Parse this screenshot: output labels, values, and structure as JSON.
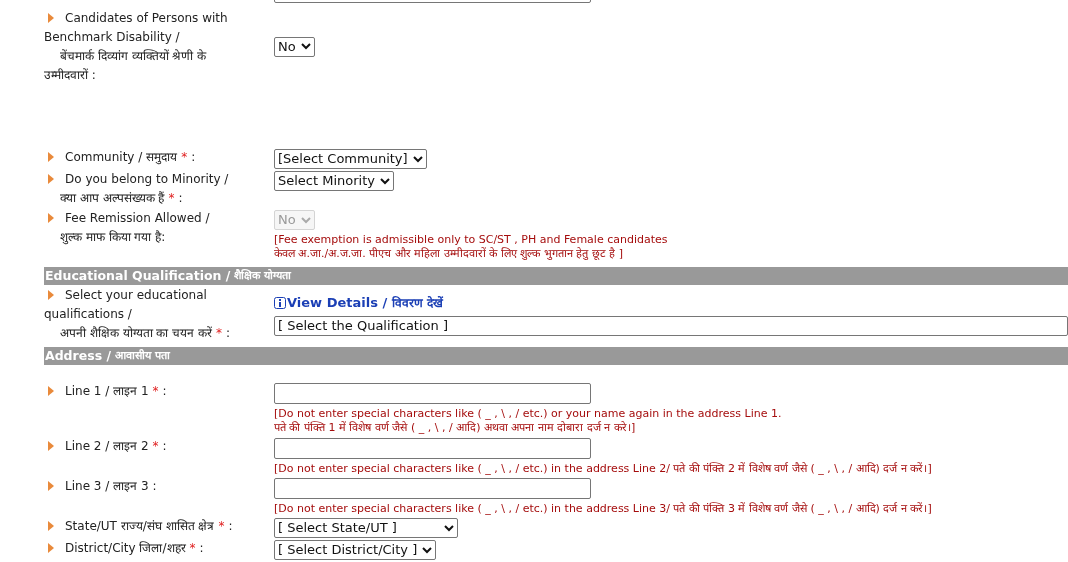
{
  "rows": [
    {
      "kind": "field",
      "control": {
        "kind": "text"
      }
    },
    {
      "kind": "field",
      "label_lines": [
        "Candidates of Persons with",
        "Benchmark Disability /",
        "बेंचमार्क दिव्यांग व्यक्तियों श्रेणी के",
        "उम्मीदवारों :"
      ],
      "control": {
        "kind": "select",
        "value": "No",
        "disabled": false
      }
    },
    {
      "kind": "field",
      "label_lines": [
        "Community / समुदाय"
      ],
      "required_mark": "*",
      "label_end": ":",
      "control": {
        "kind": "select",
        "value": "[Select Community]",
        "disabled": false
      }
    },
    {
      "kind": "field",
      "label_lines": [
        "Do you belong to Minority /",
        "क्या आप अल्पसंख्यक हैं"
      ],
      "required_mark": "*",
      "label_end": ":",
      "control": {
        "kind": "select",
        "value": "Select Minority",
        "disabled": false
      }
    },
    {
      "kind": "field",
      "label_lines": [
        "Fee Remission Allowed /",
        "शुल्क माफ किया गया है:"
      ],
      "control": {
        "kind": "select",
        "value": "No",
        "disabled": true
      },
      "hint": [
        "[Fee exemption is admissible only to SC/ST , PH and Female candidates",
        "केवल अ.जा./अ.ज.जा. पीएच और महिला उम्मीदवारों के लिए शुल्क भुगतान हेतु छूट है ]"
      ]
    },
    {
      "kind": "section",
      "title": "Educational Qualification /",
      "hindi": "शैक्षिक योग्यता"
    },
    {
      "kind": "field",
      "label_lines": [
        "Select your educational",
        "qualifications /",
        "अपनी शैक्षिक योग्यता का चयन करें"
      ],
      "required_mark": "*",
      "label_end": ":",
      "control": {
        "kind": "wide_select",
        "value": "[ Select the Qualification ]",
        "disabled": false,
        "link": "View Details /",
        "link_hindi": "विवरण देखें"
      }
    },
    {
      "kind": "section",
      "title": "Address /",
      "hindi": "आवासीय पता"
    },
    {
      "kind": "field",
      "label_lines": [
        "Line 1 / लाइन 1"
      ],
      "required_mark": "*",
      "label_end": ":",
      "control": {
        "kind": "text"
      },
      "hint": [
        "[Do not enter special characters like ( _ , \\ , / etc.) or your name again in the address Line 1.",
        "पते की पंक्ति 1 में विशेष वर्ण जैसे ( _ , \\ , / आदि) अथवा अपना नाम दोबारा दर्ज न करे।]"
      ]
    },
    {
      "kind": "field",
      "label_lines": [
        "Line 2 / लाइन 2"
      ],
      "required_mark": "*",
      "label_end": ":",
      "control": {
        "kind": "text"
      },
      "hint": [
        "[Do not enter special characters like ( _ , \\ , / etc.) in the address Line 2/ पते की पंक्ति 2 में विशेष वर्ण जैसे ( _ , \\ , / आदि) दर्ज न करें।]"
      ]
    },
    {
      "kind": "field",
      "label_lines": [
        "Line 3 / लाइन 3 :"
      ],
      "control": {
        "kind": "text"
      },
      "hint": [
        "[Do not enter special characters like ( _ , \\ , / etc.) in the address Line 3/ पते की पंक्ति 3 में विशेष वर्ण जैसे ( _ , \\ , / आदि) दर्ज न करें।]"
      ]
    },
    {
      "kind": "field",
      "label_lines": [
        "State/UT राज्य/संघ शासित क्षेत्र"
      ],
      "required_mark": "*",
      "label_end": ":",
      "control": {
        "kind": "select",
        "value": "[ Select State/UT ]",
        "disabled": false
      }
    },
    {
      "kind": "field",
      "label_lines": [
        "District/City जिला/शहर"
      ],
      "required_mark": "*",
      "label_end": ":",
      "control": {
        "kind": "select",
        "value": "[ Select District/City ]",
        "disabled": false
      }
    }
  ]
}
